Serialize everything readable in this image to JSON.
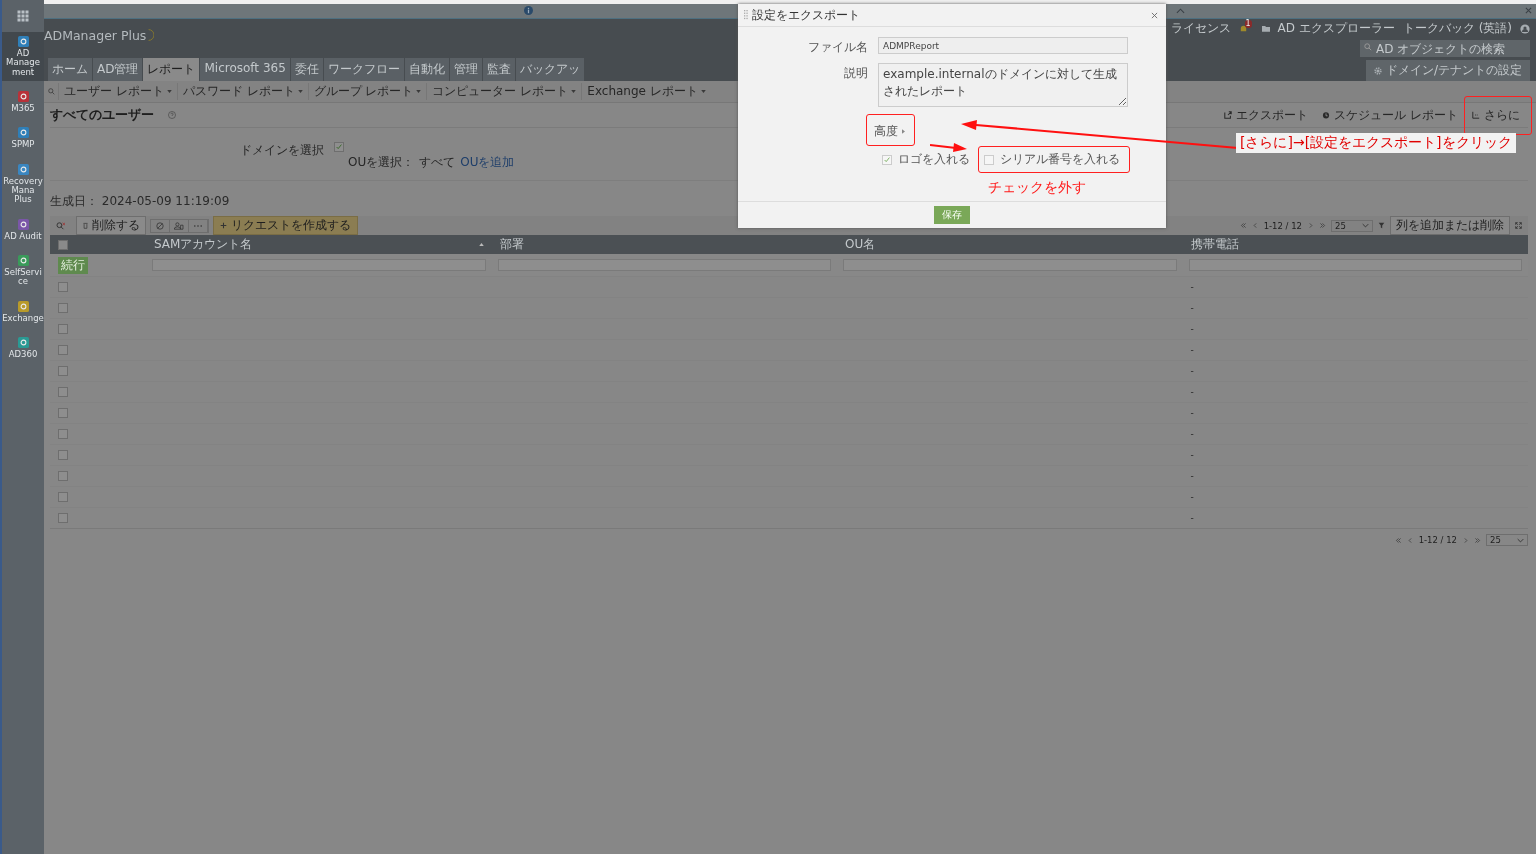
{
  "launcher": {
    "apps": [
      {
        "label": "AD Management",
        "color": "#2f7fb8",
        "selected": true
      },
      {
        "label": "M365",
        "color": "#b8323a",
        "selected": false
      },
      {
        "label": "SPMP",
        "color": "#2f7fb8",
        "selected": false
      },
      {
        "label": "RecoveryMana Plus",
        "color": "#3a86c0",
        "selected": false
      },
      {
        "label": "AD Audit",
        "color": "#7a56a8",
        "selected": false
      },
      {
        "label": "SelfService",
        "color": "#3a9a5a",
        "selected": false
      },
      {
        "label": "Exchange",
        "color": "#b89a2a",
        "selected": false
      },
      {
        "label": "AD360",
        "color": "#2a9a94",
        "selected": false
      }
    ]
  },
  "header": {
    "product": "ADManager Plus",
    "links": [
      "ライセンス",
      "AD エクスプローラー",
      "トークバック (英語)"
    ],
    "notification_count": "1",
    "search": {
      "placeholder": "AD オブジェクトの検索"
    },
    "settings_button": "ドメイン/テナントの設定"
  },
  "tabs": [
    {
      "label": "ホーム",
      "selected": false
    },
    {
      "label": "AD管理",
      "selected": false
    },
    {
      "label": "レポート",
      "selected": true
    },
    {
      "label": "Microsoft 365",
      "selected": false
    },
    {
      "label": "委任",
      "selected": false
    },
    {
      "label": "ワークフロー",
      "selected": false
    },
    {
      "label": "自動化",
      "selected": false
    },
    {
      "label": "管理",
      "selected": false
    },
    {
      "label": "監査",
      "selected": false
    },
    {
      "label": "バックアッ",
      "selected": false
    }
  ],
  "report_menu": [
    "ユーザー レポート",
    "パスワード レポート",
    "グループ レポート",
    "コンピューター レポート",
    "Exchange レポート"
  ],
  "page": {
    "title": "すべてのユーザー",
    "actions": [
      "エクスポート",
      "スケジュール レポート",
      "さらに"
    ],
    "domain_label": "ドメインを選択",
    "domain_checked": true,
    "ou_label": "OUを選択：",
    "ou_value": "すべて",
    "ou_link": "OUを追加",
    "generated": "生成日： 2024-05-09 11:19:09"
  },
  "toolbar": {
    "delete": "削除する",
    "request": "リクエストを作成する"
  },
  "pagination": {
    "range": "1-12 / 12",
    "page_size": "25",
    "columns_button": "列を追加または削除"
  },
  "table": {
    "columns": [
      "SAMアカウント名",
      "部署",
      "OU名",
      "携帯電話"
    ],
    "all_checked": false,
    "filter_button": "続行",
    "rows": [
      {
        "checked": false,
        "phone": "-"
      },
      {
        "checked": false,
        "phone": "-"
      },
      {
        "checked": false,
        "phone": "-"
      },
      {
        "checked": false,
        "phone": "-"
      },
      {
        "checked": false,
        "phone": "-"
      },
      {
        "checked": false,
        "phone": "-"
      },
      {
        "checked": false,
        "phone": "-"
      },
      {
        "checked": false,
        "phone": "-"
      },
      {
        "checked": false,
        "phone": "-"
      },
      {
        "checked": false,
        "phone": "-"
      },
      {
        "checked": false,
        "phone": "-"
      },
      {
        "checked": false,
        "phone": "-"
      }
    ]
  },
  "bottom_pagination": {
    "range": "1-12 / 12",
    "page_size": "25"
  },
  "dialog": {
    "title": "設定をエクスポート",
    "file_label": "ファイル名",
    "file_value": "ADMPReport",
    "desc_label": "説明",
    "desc_value": "example.internalのドメインに対して生成されたレポート",
    "advanced": "高度",
    "options": [
      {
        "label": "ロゴを入れる",
        "checked": true
      },
      {
        "label": "シリアル番号を入れる",
        "checked": false
      }
    ],
    "save": "保存"
  },
  "annotations": {
    "instruction": "[さらに]→[設定をエクスポート]をクリック",
    "uncheck_note": "チェックを外す"
  }
}
